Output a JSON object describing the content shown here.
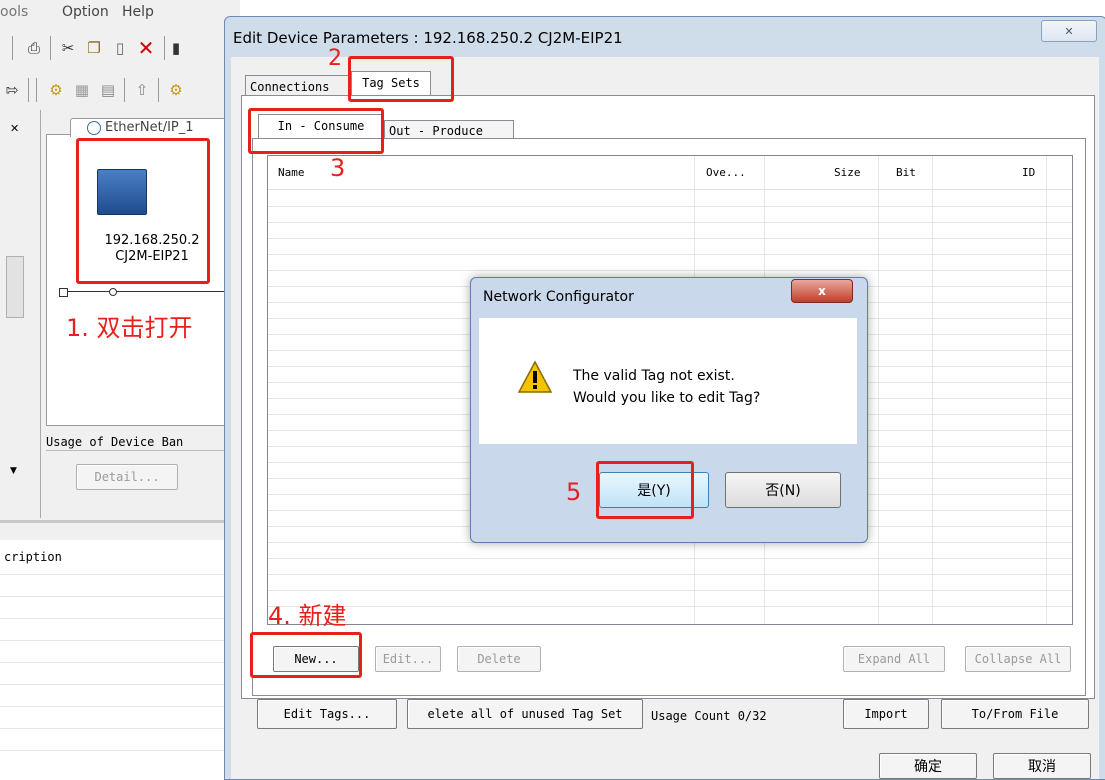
{
  "bg": {
    "menu": [
      "ools",
      "Option",
      "Help"
    ],
    "device_ip": "192.168.250.2",
    "device_model": "CJ2M-EIP21",
    "network_tab": "EtherNet/IP_1",
    "usage_group": "Usage of Device Ban",
    "detail_button": "Detail...",
    "description_header": "cription"
  },
  "dialog": {
    "title": "Edit Device Parameters : 192.168.250.2 CJ2M-EIP21",
    "close_glyph": "✕",
    "tabs": [
      "Connections",
      "Tag Sets"
    ],
    "subtabs": [
      "In - Consume",
      "Out - Produce"
    ],
    "columns": [
      "Name",
      "Ove...",
      "Size",
      "Bit",
      "ID"
    ],
    "buttons": {
      "new": "New...",
      "edit": "Edit...",
      "delete": "Delete",
      "expand_all": "Expand All",
      "collapse_all": "Collapse All",
      "edit_tags": "Edit Tags...",
      "delete_unused": "elete all of unused Tag Set",
      "usage_count": "Usage Count 0/32",
      "import": "Import",
      "to_from_file": "To/From File",
      "ok": "确定",
      "cancel": "取消"
    }
  },
  "msgbox": {
    "title": "Network Configurator",
    "close_glyph": "x",
    "line1": "The valid Tag not exist.",
    "line2": "Would you like to edit Tag?",
    "yes": "是(Y)",
    "no": "否(N)"
  },
  "annotations": {
    "step1": "1. 双击打开",
    "step2": "2",
    "step3": "3",
    "step4": "4. 新建",
    "step5": "5",
    "color": "#e8201c"
  }
}
